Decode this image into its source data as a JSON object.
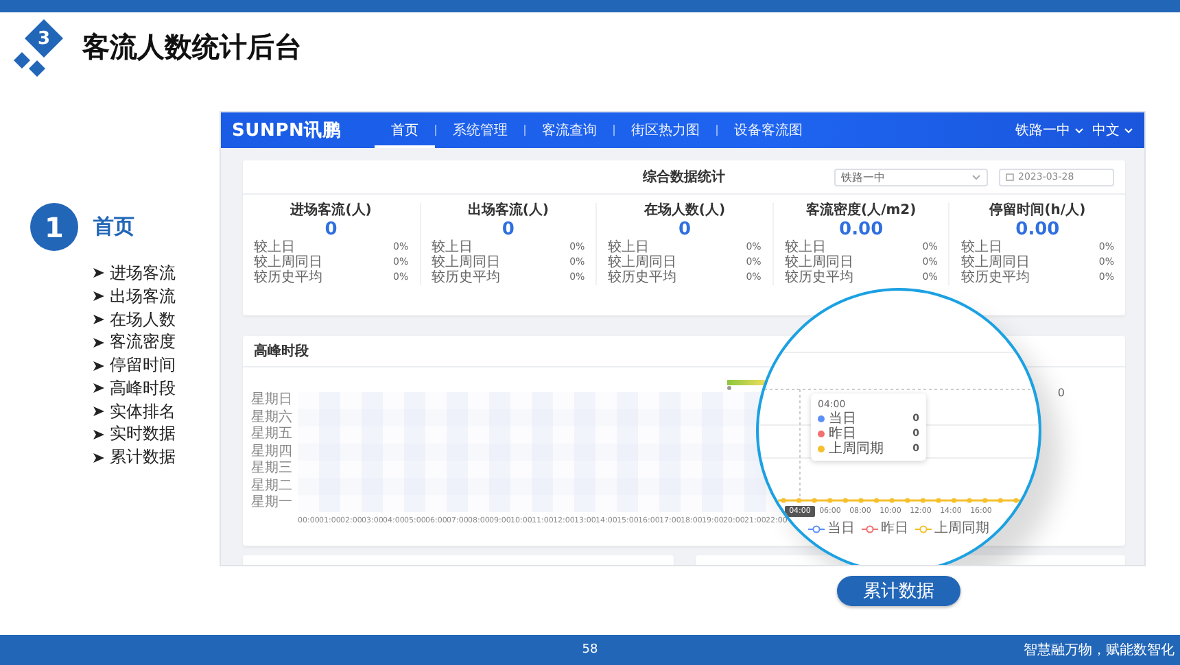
{
  "slide": {
    "section_number": "3",
    "title": "客流人数统计后台",
    "topic_number": "1",
    "topic": "首页",
    "bullets": [
      "进场客流",
      "出场客流",
      "在场人数",
      "客流密度",
      "停留时间",
      "高峰时段",
      "实体排名",
      "实时数据",
      "累计数据"
    ],
    "caption_button": "累计数据",
    "page_number": "58",
    "slogan": "智慧融万物，赋能数智化"
  },
  "app": {
    "logo": "SUNPN讯鹏",
    "nav": [
      {
        "label": "首页",
        "selected": true
      },
      {
        "label": "系统管理",
        "selected": false
      },
      {
        "label": "客流查询",
        "selected": false
      },
      {
        "label": "街区热力图",
        "selected": false
      },
      {
        "label": "设备客流图",
        "selected": false
      }
    ],
    "site_menu": "铁路一中",
    "language_menu": "中文",
    "summary": {
      "title": "综合数据统计",
      "site_select": "铁路一中",
      "date": "2023-03-28",
      "stats": [
        {
          "title": "进场客流(人)",
          "value": "0",
          "rows": [
            {
              "label": "较上日",
              "change": "0%"
            },
            {
              "label": "较上周同日",
              "change": "0%"
            },
            {
              "label": "较历史平均",
              "change": "0%"
            }
          ]
        },
        {
          "title": "出场客流(人)",
          "value": "0",
          "rows": [
            {
              "label": "较上日",
              "change": "0%"
            },
            {
              "label": "较上周同日",
              "change": "0%"
            },
            {
              "label": "较历史平均",
              "change": "0%"
            }
          ]
        },
        {
          "title": "在场人数(人)",
          "value": "0",
          "rows": [
            {
              "label": "较上日",
              "change": "0%"
            },
            {
              "label": "较上周同日",
              "change": "0%"
            },
            {
              "label": "较历史平均",
              "change": "0%"
            }
          ]
        },
        {
          "title": "客流密度(人/m2)",
          "value": "0.00",
          "rows": [
            {
              "label": "较上日",
              "change": "0%"
            },
            {
              "label": "较上周同日",
              "change": "0%"
            },
            {
              "label": "较历史平均",
              "change": "0%"
            }
          ]
        },
        {
          "title": "停留时间(h/人)",
          "value": "0.00",
          "rows": [
            {
              "label": "较上日",
              "change": "0%"
            },
            {
              "label": "较上周同日",
              "change": "0%"
            },
            {
              "label": "较历史平均",
              "change": "0%"
            }
          ]
        }
      ]
    },
    "peak": {
      "title": "高峰时段",
      "y_labels": [
        "星期日",
        "星期六",
        "星期五",
        "星期四",
        "星期三",
        "星期二",
        "星期一"
      ],
      "x_labels": [
        "00:00",
        "01:00",
        "02:00",
        "03:00",
        "04:00",
        "05:00",
        "06:00",
        "07:00",
        "08:00",
        "09:00",
        "10:00",
        "11:00",
        "12:00",
        "13:00",
        "14:00",
        "15:00",
        "16:00",
        "17:00",
        "18:00",
        "19:00",
        "20:00",
        "21:00",
        "22:00"
      ],
      "scale_label": "0"
    },
    "magnifier": {
      "tooltip": {
        "time": "04:00",
        "items": [
          {
            "name": "当日",
            "value": "0",
            "color": "#5b8ff9"
          },
          {
            "name": "昨日",
            "value": "0",
            "color": "#f0716f"
          },
          {
            "name": "上周同期",
            "value": "0",
            "color": "#f6c02d"
          }
        ]
      },
      "x_labels": [
        {
          "label": "04:00",
          "highlighted": true
        },
        {
          "label": "06:00",
          "highlighted": false
        },
        {
          "label": "08:00",
          "highlighted": false
        },
        {
          "label": "10:00",
          "highlighted": false
        },
        {
          "label": "12:00",
          "highlighted": false
        },
        {
          "label": "14:00",
          "highlighted": false
        },
        {
          "label": "16:00",
          "highlighted": false
        }
      ],
      "legend": [
        {
          "name": "当日",
          "color": "#5b8ff9"
        },
        {
          "name": "昨日",
          "color": "#f0716f"
        },
        {
          "name": "上周同期",
          "color": "#f6c02d"
        }
      ]
    }
  }
}
